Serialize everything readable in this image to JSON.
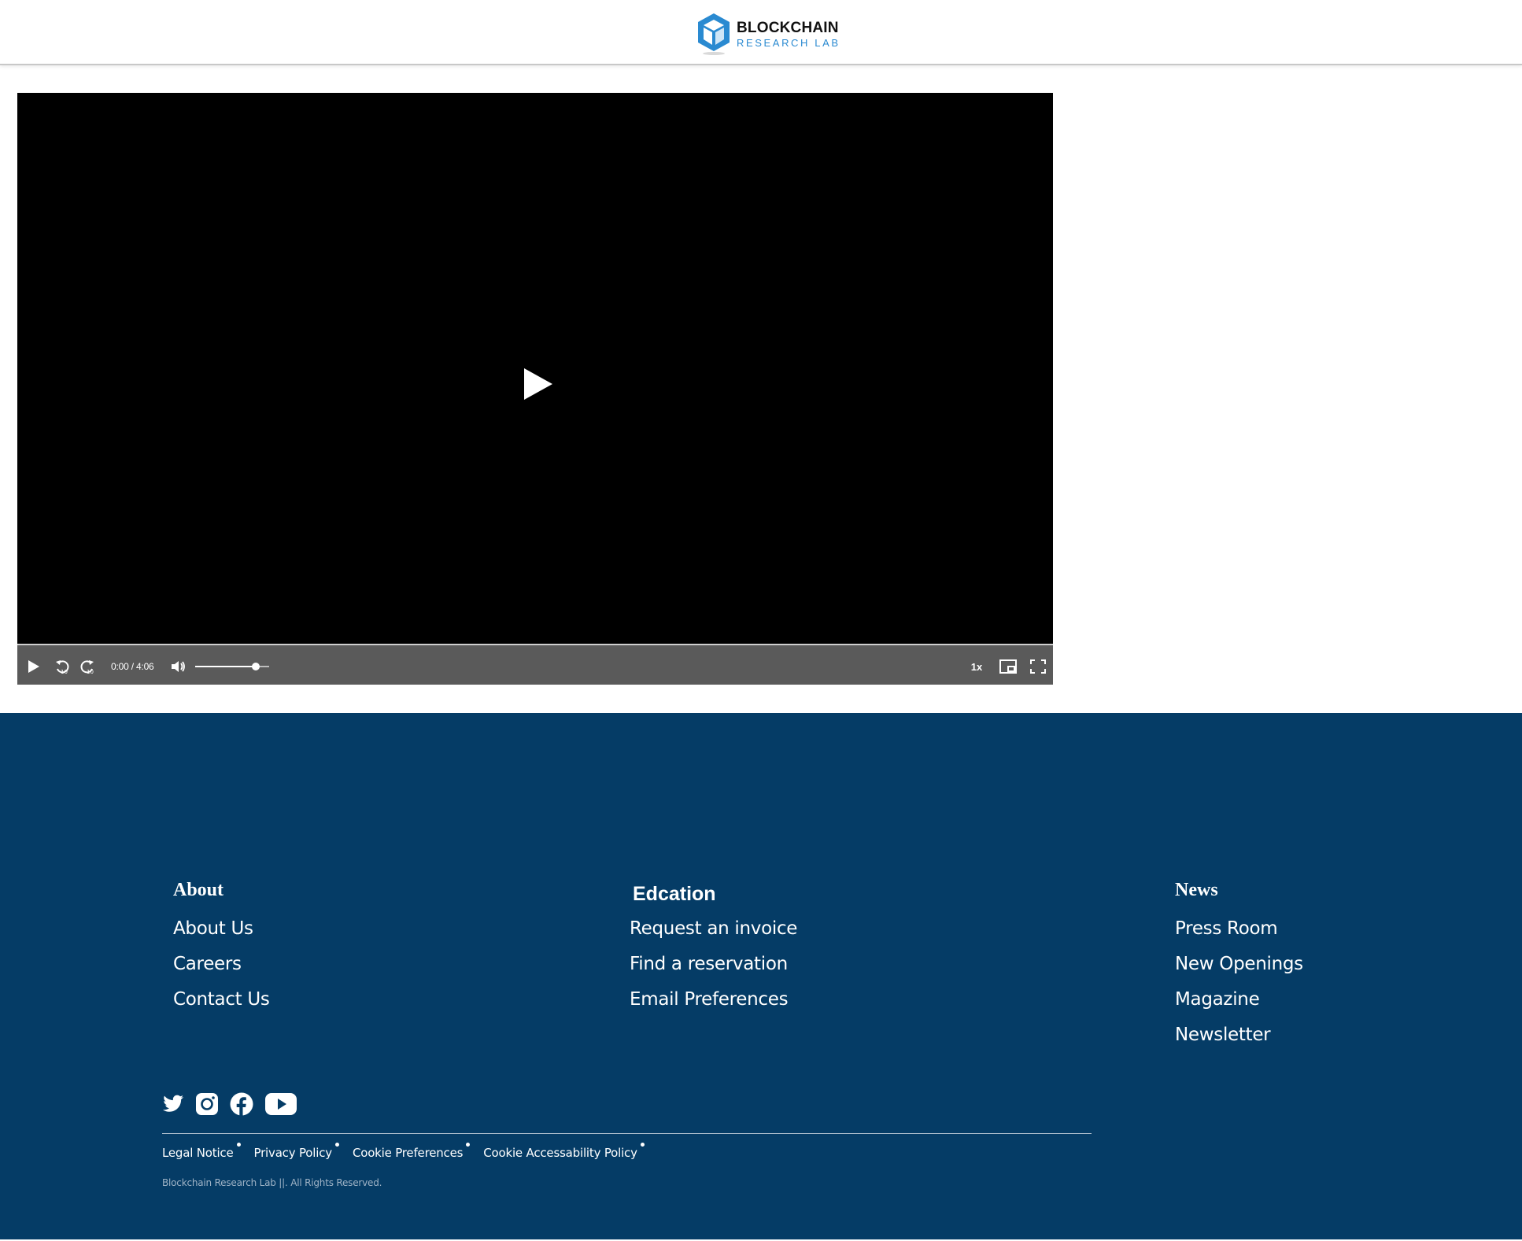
{
  "header": {
    "logo_title": "BLOCKCHAIN",
    "logo_subtitle": "RESEARCH LAB"
  },
  "player": {
    "current_time": "0:00",
    "duration": "4:06",
    "time_display": "0:00 / 4:06",
    "playback_speed": "1x",
    "volume_fraction": 0.82,
    "progress_fraction": 0
  },
  "footer": {
    "columns": [
      {
        "heading": "About",
        "links": [
          "About Us",
          "Careers",
          "Contact Us"
        ]
      },
      {
        "heading": "Edcation",
        "links": [
          "Request an invoice",
          "Find a reservation",
          "Email Preferences"
        ]
      },
      {
        "heading": "News",
        "links": [
          "Press Room",
          "New Openings",
          "Magazine",
          "Newsletter"
        ]
      }
    ],
    "social": [
      "twitter-icon",
      "instagram-icon",
      "facebook-icon",
      "youtube-icon"
    ],
    "legal_links": [
      "Legal Notice",
      "Privacy Policy",
      "Cookie Preferences",
      "Cookie Accessability Policy"
    ],
    "copyright": "Blockchain Research Lab ||. All Rights Reserved."
  },
  "colors": {
    "footer_bg": "#053c66",
    "brand_blue": "#2a8ad1",
    "control_bar": "#5a5a5a"
  }
}
